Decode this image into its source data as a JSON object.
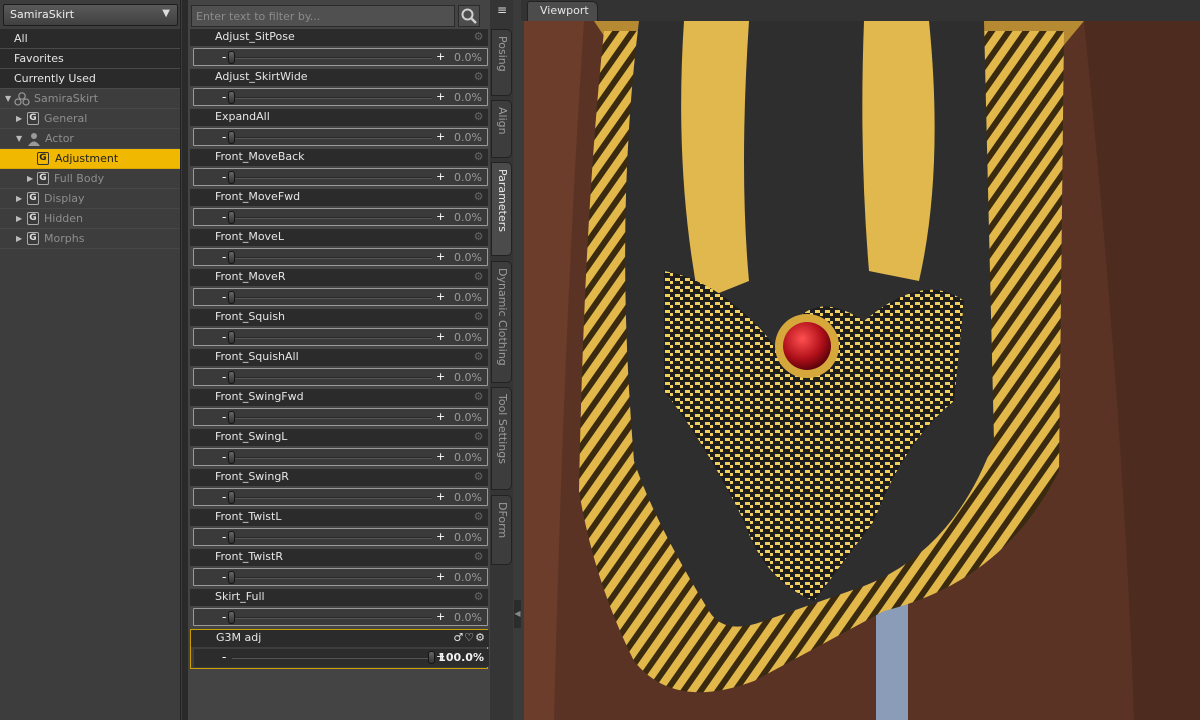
{
  "node_selector": {
    "value": "SamiraSkirt",
    "arrow": "▼"
  },
  "filters": [
    "All",
    "Favorites",
    "Currently Used"
  ],
  "tree": {
    "root": "SamiraSkirt",
    "general": "General",
    "actor": "Actor",
    "adjustment": "Adjustment",
    "full_body": "Full Body",
    "display": "Display",
    "hidden": "Hidden",
    "morphs": "Morphs",
    "group_icon": "G"
  },
  "search": {
    "placeholder": "Enter text to filter by..."
  },
  "sliders": [
    {
      "name": "Adjust_SitPose",
      "value": "0.0%",
      "fraction": 0.0
    },
    {
      "name": "Adjust_SkirtWide",
      "value": "0.0%",
      "fraction": 0.0
    },
    {
      "name": "ExpandAll",
      "value": "0.0%",
      "fraction": 0.0
    },
    {
      "name": "Front_MoveBack",
      "value": "0.0%",
      "fraction": 0.0
    },
    {
      "name": "Front_MoveFwd",
      "value": "0.0%",
      "fraction": 0.0
    },
    {
      "name": "Front_MoveL",
      "value": "0.0%",
      "fraction": 0.0
    },
    {
      "name": "Front_MoveR",
      "value": "0.0%",
      "fraction": 0.0
    },
    {
      "name": "Front_Squish",
      "value": "0.0%",
      "fraction": 0.0
    },
    {
      "name": "Front_SquishAll",
      "value": "0.0%",
      "fraction": 0.0
    },
    {
      "name": "Front_SwingFwd",
      "value": "0.0%",
      "fraction": 0.0
    },
    {
      "name": "Front_SwingL",
      "value": "0.0%",
      "fraction": 0.0
    },
    {
      "name": "Front_SwingR",
      "value": "0.0%",
      "fraction": 0.0
    },
    {
      "name": "Front_TwistL",
      "value": "0.0%",
      "fraction": 0.0
    },
    {
      "name": "Front_TwistR",
      "value": "0.0%",
      "fraction": 0.0
    },
    {
      "name": "Skirt_Full",
      "value": "0.0%",
      "fraction": 0.0
    }
  ],
  "active_slider": {
    "name": "G3M adj",
    "value": "100.0%",
    "fraction": 1.0
  },
  "slider_symbols": {
    "minus": "-",
    "plus": "+"
  },
  "side_tabs": [
    "Posing",
    "Align",
    "Parameters",
    "Dynamic Clothing",
    "Tool Settings",
    "DForm"
  ],
  "active_side_tab": "Parameters",
  "viewport": {
    "tab_label": "Viewport"
  },
  "colors": {
    "selection": "#f0b800",
    "accent_border": "#c9a000",
    "skin": "#5a3324",
    "gold": "#e8c45a",
    "cloth": "#2d2d2d",
    "gem": "#b0101a"
  },
  "icons": {
    "search": "search-icon",
    "gear": "gear-icon",
    "menu": "menu-icon",
    "figure": "figure-icon",
    "actor": "actor-icon"
  }
}
